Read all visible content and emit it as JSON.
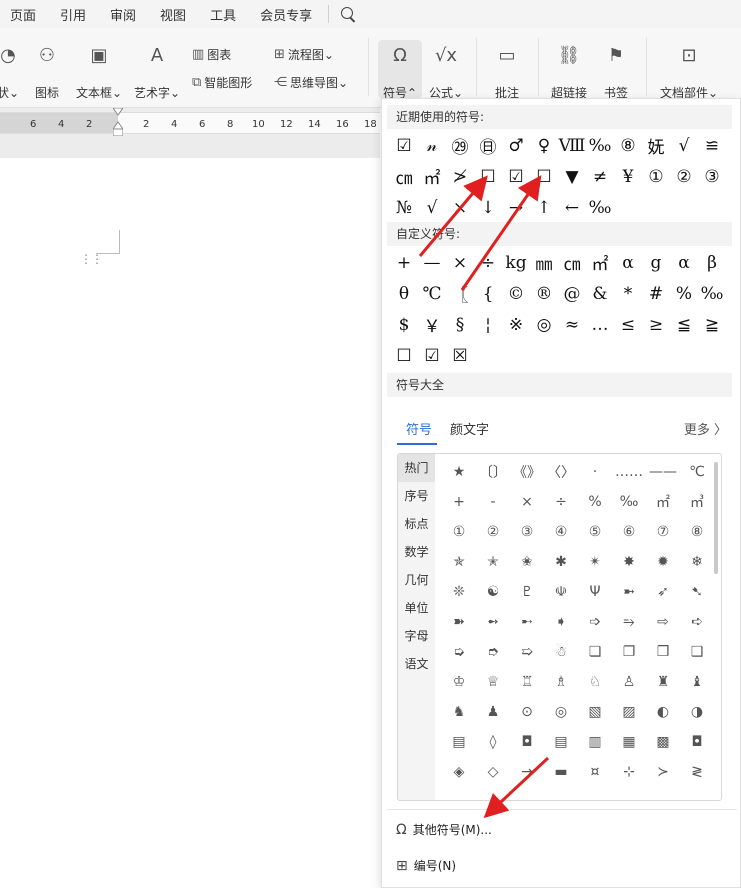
{
  "menubar": {
    "items": [
      "页面",
      "引用",
      "审阅",
      "视图",
      "工具",
      "会员专享"
    ]
  },
  "ribbon": {
    "items": [
      {
        "label": "状⌄",
        "icon": "circle-partial-icon"
      },
      {
        "label": "图标",
        "icon": "shapes-icon"
      },
      {
        "label": "文本框⌄",
        "icon": "textbox-icon"
      },
      {
        "label": "艺术字⌄",
        "icon": "wordart-icon"
      },
      {
        "label": "图表",
        "icon": "chart-icon"
      },
      {
        "label": "智能图形",
        "icon": "smartart-icon"
      },
      {
        "label": "流程图⌄",
        "icon": "flowchart-icon"
      },
      {
        "label": "思维导图⌄",
        "icon": "mindmap-icon"
      },
      {
        "label": "符号⌃",
        "icon": "omega-icon"
      },
      {
        "label": "公式⌄",
        "icon": "formula-icon"
      },
      {
        "label": "批注",
        "icon": "comment-icon"
      },
      {
        "label": "超链接",
        "icon": "hyperlink-icon"
      },
      {
        "label": "书签",
        "icon": "bookmark-icon"
      },
      {
        "label": "文档部件⌄",
        "icon": "docpart-icon"
      }
    ]
  },
  "ruler": {
    "numbers": [
      "6",
      "4",
      "2",
      "2",
      "4",
      "6",
      "8",
      "10",
      "12",
      "14",
      "16",
      "18"
    ]
  },
  "panel": {
    "recent_title": "近期使用的符号:",
    "recent_symbols": [
      "☑",
      "𝓃",
      "㉙",
      "㊐",
      "♂",
      "♀",
      "Ⅷ",
      "‰",
      "⑧",
      "妩",
      "√",
      "≌",
      "㎝",
      "㎡",
      "≯",
      "☐",
      "☑",
      "☐",
      "▼",
      "≠",
      "¥",
      "①",
      "②",
      "③",
      "№",
      "√",
      "×",
      "↓",
      "→",
      "↑",
      "←",
      "‰"
    ],
    "custom_title": "自定义符号:",
    "custom_symbols": [
      "+",
      "—",
      "×",
      "÷",
      "kg",
      "㎜",
      "㎝",
      "㎡",
      "α",
      "g",
      "α",
      "β",
      "θ",
      "℃",
      "〖",
      "{",
      "©",
      "®",
      "@",
      "&",
      "*",
      "#",
      "%",
      "‰",
      "$",
      "￥",
      "§",
      "¦",
      "※",
      "◎",
      "≈",
      "…",
      "≤",
      "≥",
      "≦",
      "≧",
      "☐",
      "☑",
      "☒"
    ],
    "all_title": "符号大全",
    "tabs": [
      "符号",
      "颜文字"
    ],
    "more": "更多 〉",
    "categories": [
      "热门",
      "序号",
      "标点",
      "数学",
      "几何",
      "单位",
      "字母",
      "语文"
    ],
    "hot_symbols": [
      "★",
      "〔〕",
      "《》",
      "〈〉",
      "·",
      "……",
      "——",
      "℃",
      "+",
      "-",
      "×",
      "÷",
      "%",
      "‰",
      "㎡",
      "㎥",
      "①",
      "②",
      "③",
      "④",
      "⑤",
      "⑥",
      "⑦",
      "⑧",
      "✯",
      "✭",
      "✬",
      "✱",
      "✴",
      "✸",
      "✹",
      "❄",
      "❊",
      "☯",
      "♇",
      "☫",
      "Ψ",
      "➼",
      "➶",
      "➷",
      "➽",
      "➻",
      "➸",
      "➧",
      "➩",
      "⥱",
      "⇨",
      "➪",
      "➭",
      "➮",
      "➯",
      "☃",
      "❏",
      "❐",
      "❒",
      "❑",
      "♔",
      "♕",
      "♖",
      "♗",
      "♘",
      "♙",
      "♜",
      "♝",
      "♞",
      "♟",
      "⊙",
      "◎",
      "▧",
      "▨",
      "◐",
      "◑",
      "▤",
      "◊",
      "◘",
      "▤",
      "▥",
      "▦",
      "▩",
      "◘",
      "◈",
      "◇",
      "→",
      "▬",
      "¤",
      "⊹",
      "≻",
      "≷"
    ],
    "other_symbols": "其他符号(M)...",
    "numbering": "编号(N)"
  }
}
